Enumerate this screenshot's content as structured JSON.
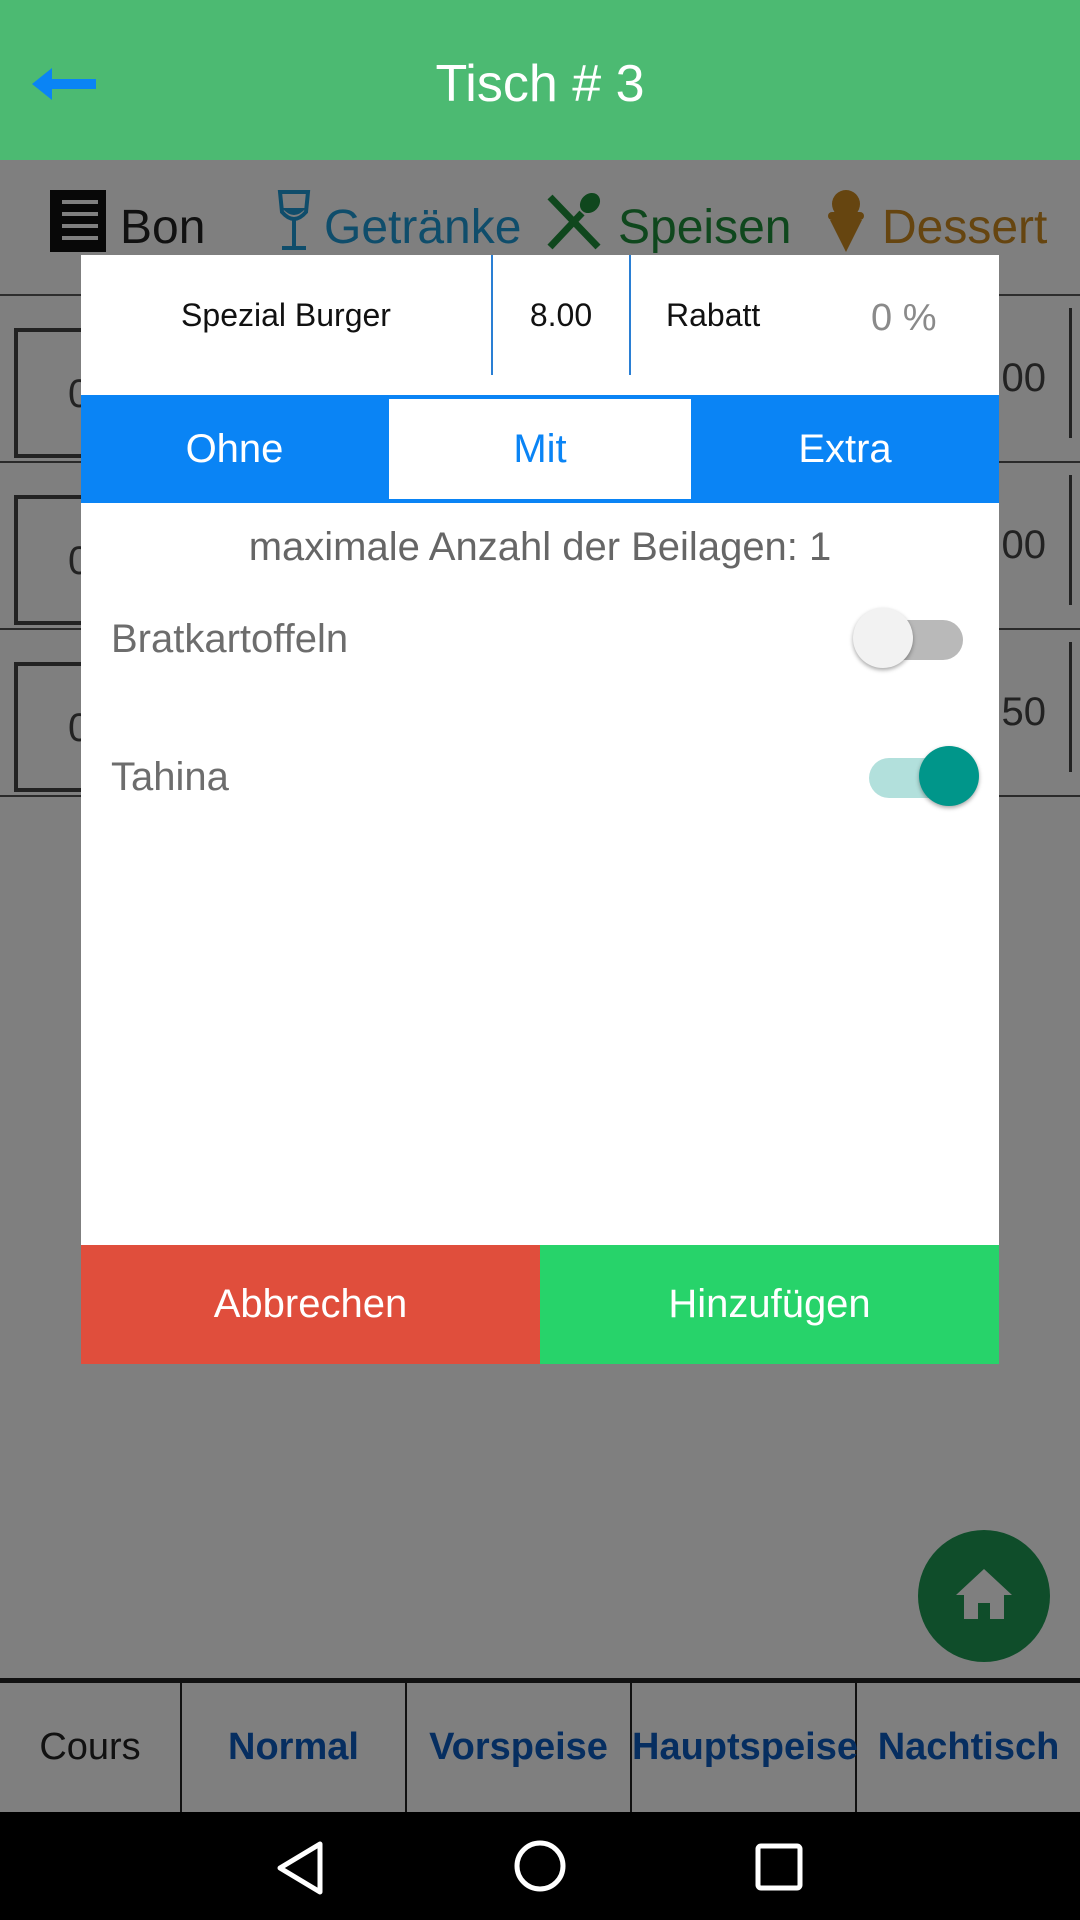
{
  "header": {
    "title": "Tisch # 3"
  },
  "categories": [
    {
      "label": "Bon",
      "icon": "receipt-icon",
      "color": "#222222"
    },
    {
      "label": "Getränke",
      "icon": "wine-glass-icon",
      "color": "#1f9ad6"
    },
    {
      "label": "Speisen",
      "icon": "cutlery-icon",
      "color": "#1e8f3a"
    },
    {
      "label": "Dessert",
      "icon": "ice-cream-icon",
      "color": "#cc8a20"
    }
  ],
  "order_rows": [
    {
      "qty": "0",
      "price": "00"
    },
    {
      "qty": "0",
      "price": "00"
    },
    {
      "qty": "0",
      "price": "50"
    }
  ],
  "dialog": {
    "item_name": "Spezial Burger",
    "item_price": "8.00",
    "discount_label": "Rabatt",
    "discount_value": "0 %",
    "tabs": [
      {
        "label": "Ohne",
        "active": false
      },
      {
        "label": "Mit",
        "active": true
      },
      {
        "label": "Extra",
        "active": false
      }
    ],
    "max_sides_text": "maximale Anzahl der Beilagen: 1",
    "options": [
      {
        "label": "Bratkartoffeln",
        "enabled": false
      },
      {
        "label": "Tahina",
        "enabled": true
      }
    ],
    "cancel_label": "Abbrechen",
    "add_label": "Hinzufügen"
  },
  "course_bar": {
    "label": "Cours",
    "courses": [
      "Normal",
      "Vorspeise",
      "Hauptspeise",
      "Nachtisch"
    ]
  },
  "colors": {
    "app_bar": "#4cba72",
    "accent_blue": "#0a84f5",
    "cancel_red": "#e04e3c",
    "add_green": "#27d36a",
    "switch_on": "#00968a"
  }
}
